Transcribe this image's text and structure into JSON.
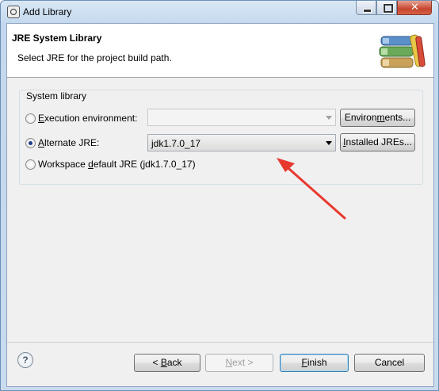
{
  "window": {
    "title": "Add Library"
  },
  "header": {
    "title": "JRE System Library",
    "description": "Select JRE for the project build path."
  },
  "group": {
    "label": "System library"
  },
  "options": {
    "execution": {
      "pre": "",
      "key": "E",
      "post": "xecution environment:",
      "checked": false
    },
    "alternate": {
      "pre": "",
      "key": "A",
      "post": "lternate JRE:",
      "checked": true
    },
    "workspace": {
      "pre": "Workspace ",
      "key": "d",
      "post": "efault JRE (jdk1.7.0_17)",
      "checked": false
    }
  },
  "combos": {
    "execution_value": "",
    "alternate_value": "jdk1.7.0_17"
  },
  "buttons": {
    "environments": {
      "pre": "Environ",
      "key": "m",
      "post": "ents..."
    },
    "installed": {
      "pre": "",
      "key": "I",
      "post": "nstalled JREs..."
    },
    "back": {
      "pre": "< ",
      "key": "B",
      "post": "ack"
    },
    "next": {
      "pre": "",
      "key": "N",
      "post": "ext >"
    },
    "finish": {
      "pre": "",
      "key": "F",
      "post": "inish"
    },
    "cancel": "Cancel",
    "help": "?"
  },
  "colors": {
    "annotation_arrow": "#e8392f"
  }
}
